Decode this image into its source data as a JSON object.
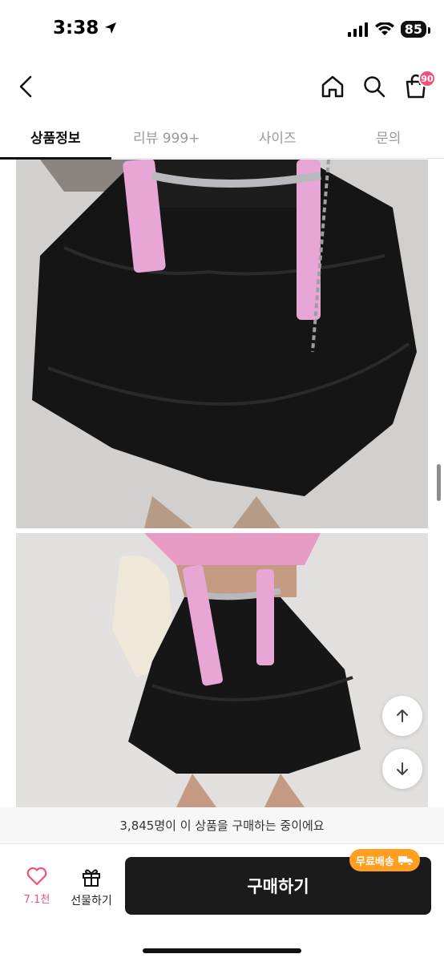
{
  "status_bar": {
    "time": "3:38",
    "battery": "85"
  },
  "header": {
    "cart_badge": "90"
  },
  "tabs": [
    {
      "label": "상품정보",
      "active": true
    },
    {
      "label": "리뷰 999+",
      "active": false
    },
    {
      "label": "사이즈",
      "active": false
    },
    {
      "label": "문의",
      "active": false
    }
  ],
  "buying_strip": {
    "text": "3,845명이 이 상품을 구매하는 중이에요"
  },
  "bottom_bar": {
    "like_count": "7.1천",
    "gift_label": "선물하기",
    "buy_label": "구매하기",
    "free_shipping": "무료배송"
  },
  "colors": {
    "accent": "#f0517a",
    "buy_button": "#1b1b1b",
    "badge_orange": "#ff9e1f"
  }
}
